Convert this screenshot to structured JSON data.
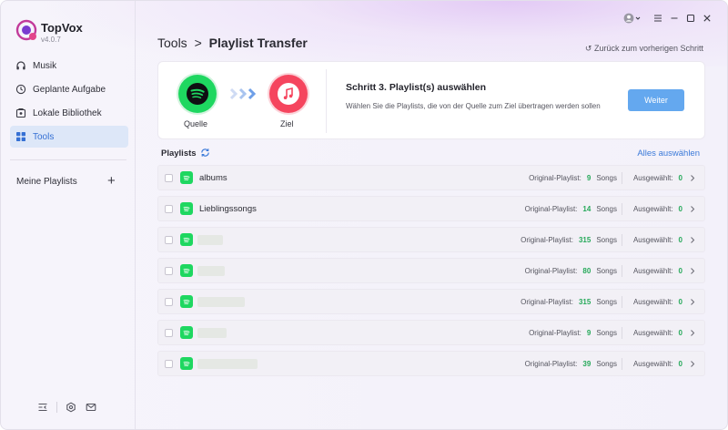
{
  "app": {
    "name": "TopVox",
    "version": "v4.0.7"
  },
  "sidebar": {
    "items": [
      {
        "label": "Musik",
        "icon": "headphones-icon"
      },
      {
        "label": "Geplante Aufgabe",
        "icon": "clock-icon"
      },
      {
        "label": "Lokale Bibliothek",
        "icon": "library-icon"
      },
      {
        "label": "Tools",
        "icon": "grid-icon",
        "active": true
      }
    ],
    "my_playlists_label": "Meine Playlists",
    "add_label": "+"
  },
  "header": {
    "breadcrumb_parent": "Tools",
    "breadcrumb_sep": ">",
    "breadcrumb_current": "Playlist Transfer",
    "back_link": "↺ Zurück zum vorherigen Schritt"
  },
  "transfer": {
    "source_label": "Quelle",
    "target_label": "Ziel",
    "step_title": "Schritt 3. Playlist(s) auswählen",
    "step_desc": "Wählen Sie die Playlists, die von der Quelle zum Ziel übertragen werden sollen",
    "next_label": "Weiter"
  },
  "playlists": {
    "header": "Playlists",
    "select_all": "Alles auswählen",
    "orig_label": "Original-Playlist:",
    "songs_label": "Songs",
    "selected_label": "Ausgewählt:",
    "rows": [
      {
        "name": "albums",
        "count": "9",
        "selected": "0"
      },
      {
        "name": "Lieblingssongs",
        "count": "14",
        "selected": "0"
      },
      {
        "name": "",
        "count": "315",
        "selected": "0"
      },
      {
        "name": "",
        "count": "80",
        "selected": "0"
      },
      {
        "name": "",
        "count": "315",
        "selected": "0"
      },
      {
        "name": "",
        "count": "9",
        "selected": "0"
      },
      {
        "name": "",
        "count": "39",
        "selected": "0"
      }
    ]
  },
  "colors": {
    "accent": "#3b7ad9",
    "spotify": "#1ed760",
    "apple_music": "#f5455e",
    "button": "#64a8ef",
    "count": "#26a95a"
  }
}
